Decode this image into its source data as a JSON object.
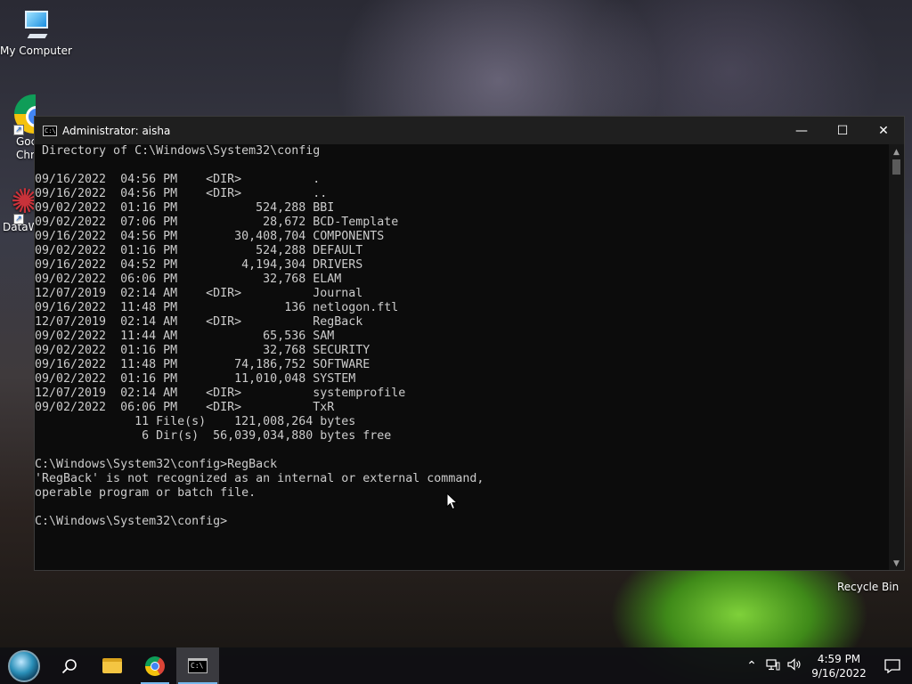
{
  "desktop": {
    "icons": [
      {
        "label": "My Computer"
      },
      {
        "label": "Goc\nChr"
      },
      {
        "label": "DataW"
      }
    ],
    "recycle_bin": "Recycle Bin"
  },
  "window": {
    "title": "Administrator: aisha",
    "minimize_glyph": "—",
    "maximize_glyph": "☐",
    "close_glyph": "✕",
    "console_lines": [
      " Directory of C:\\Windows\\System32\\config",
      "",
      "09/16/2022  04:56 PM    <DIR>          .",
      "09/16/2022  04:56 PM    <DIR>          ..",
      "09/02/2022  01:16 PM           524,288 BBI",
      "09/02/2022  07:06 PM            28,672 BCD-Template",
      "09/16/2022  04:56 PM        30,408,704 COMPONENTS",
      "09/02/2022  01:16 PM           524,288 DEFAULT",
      "09/16/2022  04:52 PM         4,194,304 DRIVERS",
      "09/02/2022  06:06 PM            32,768 ELAM",
      "12/07/2019  02:14 AM    <DIR>          Journal",
      "09/16/2022  11:48 PM               136 netlogon.ftl",
      "12/07/2019  02:14 AM    <DIR>          RegBack",
      "09/02/2022  11:44 AM            65,536 SAM",
      "09/02/2022  01:16 PM            32,768 SECURITY",
      "09/16/2022  11:48 PM        74,186,752 SOFTWARE",
      "09/02/2022  01:16 PM        11,010,048 SYSTEM",
      "12/07/2019  02:14 AM    <DIR>          systemprofile",
      "09/02/2022  06:06 PM    <DIR>          TxR",
      "              11 File(s)    121,008,264 bytes",
      "               6 Dir(s)  56,039,034,880 bytes free",
      "",
      "C:\\Windows\\System32\\config>RegBack",
      "'RegBack' is not recognized as an internal or external command,",
      "operable program or batch file.",
      "",
      "C:\\Windows\\System32\\config>"
    ]
  },
  "taskbar": {
    "time": "4:59 PM",
    "date": "9/16/2022",
    "icons": [
      "start-orb",
      "search-icon",
      "file-explorer-icon",
      "chrome-icon",
      "cmd-icon"
    ],
    "tray_icons": [
      "chevron-up-icon",
      "network-icon",
      "volume-icon",
      "notification-icon"
    ]
  }
}
